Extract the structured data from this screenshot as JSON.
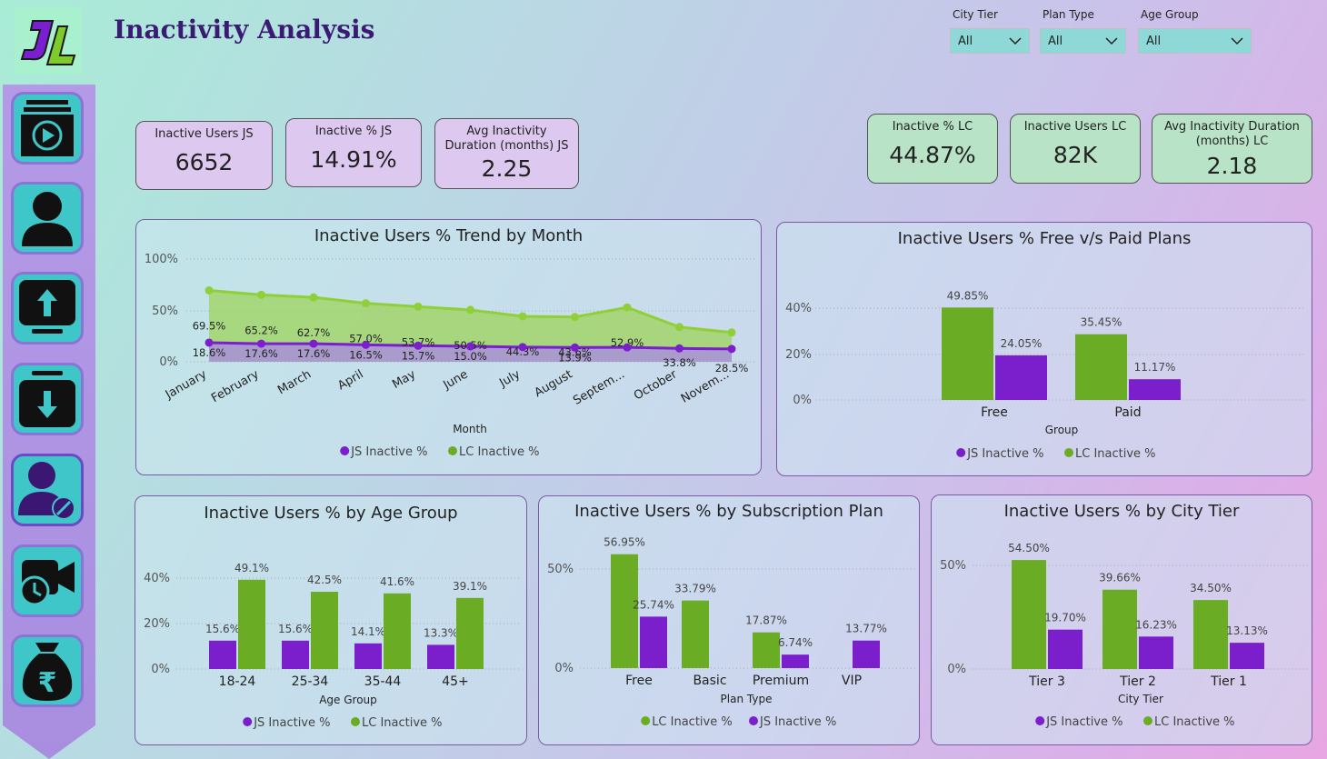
{
  "page": {
    "title": "Inactivity Analysis"
  },
  "colors": {
    "js": "#7b1fcc",
    "lc": "#6aac24",
    "lc_light": "#8fd03a",
    "nav_teal": "#3fc6c9"
  },
  "filters": [
    {
      "label": "City Tier",
      "value": "All"
    },
    {
      "label": "Plan Type",
      "value": "All"
    },
    {
      "label": "Age Group",
      "value": "All"
    }
  ],
  "nav": [
    "dashboard-icon",
    "user-icon",
    "upload-icon",
    "download-icon",
    "user-blocked-icon",
    "video-call-icon",
    "rupee-bag-icon"
  ],
  "kpis_js": [
    {
      "label": "Inactive Users JS",
      "value": "6652"
    },
    {
      "label": "Inactive % JS",
      "value": "14.91%"
    },
    {
      "label1": "Avg Inactivity",
      "label2": "Duration (months) JS",
      "value": "2.25"
    }
  ],
  "kpis_lc": [
    {
      "label": "Inactive % LC",
      "value": "44.87%"
    },
    {
      "label": "Inactive Users LC",
      "value": "82K"
    },
    {
      "label1": "Avg Inactivity Duration",
      "label2": "(months) LC",
      "value": "2.18"
    }
  ],
  "charts": {
    "trend": {
      "title": "Inactive Users % Trend by Month",
      "xlabel": "Month",
      "yticks": [
        "100%",
        "50%",
        "0%"
      ],
      "legend": [
        "JS Inactive %",
        "LC Inactive %"
      ]
    },
    "plans": {
      "title": "Inactive Users % Free v/s Paid Plans",
      "xlabel": "Group",
      "yticks": [
        "40%",
        "20%",
        "0%"
      ],
      "legend": [
        "JS Inactive %",
        "LC Inactive %"
      ]
    },
    "age": {
      "title": "Inactive Users % by Age Group",
      "xlabel": "Age Group",
      "yticks": [
        "40%",
        "20%",
        "0%"
      ],
      "legend": [
        "JS Inactive %",
        "LC Inactive %"
      ]
    },
    "sub": {
      "title": "Inactive Users % by Subscription Plan",
      "xlabel": "Plan Type",
      "yticks": [
        "50%",
        "0%"
      ],
      "legend": [
        "LC Inactive %",
        "JS Inactive %"
      ]
    },
    "city": {
      "title": "Inactive Users % by City Tier",
      "xlabel": "City Tier",
      "yticks": [
        "50%",
        "0%"
      ],
      "legend": [
        "JS Inactive %",
        "LC Inactive %"
      ]
    }
  },
  "chart_data": [
    {
      "type": "area",
      "title": "Inactive Users % Trend by Month",
      "xlabel": "Month",
      "categories": [
        "January",
        "February",
        "March",
        "April",
        "May",
        "June",
        "July",
        "August",
        "Septem...",
        "October",
        "Novem..."
      ],
      "series": [
        {
          "name": "JS Inactive %",
          "values": [
            18.6,
            17.6,
            17.6,
            16.5,
            15.7,
            15.0,
            14.3,
            13.9,
            14.0,
            13.0,
            12.5
          ],
          "labels": [
            "18.6%",
            "17.6%",
            "17.6%",
            "16.5%",
            "15.7%",
            "15.0%",
            "",
            "13.9%",
            "",
            "",
            ""
          ]
        },
        {
          "name": "LC Inactive %",
          "values": [
            69.5,
            65.2,
            62.7,
            57.0,
            53.7,
            50.5,
            44.3,
            43.6,
            52.9,
            33.8,
            28.5
          ],
          "labels": [
            "69.5%",
            "65.2%",
            "62.7%",
            "57.0%",
            "53.7%",
            "50.5%",
            "44.3%",
            "43.6%",
            "52.9%",
            "33.8%",
            "28.5%"
          ]
        }
      ],
      "ylim": [
        0,
        100
      ],
      "legend": "bottom"
    },
    {
      "type": "bar",
      "title": "Inactive Users % Free v/s Paid Plans",
      "xlabel": "Group",
      "categories": [
        "Free",
        "Paid"
      ],
      "series": [
        {
          "name": "LC Inactive %",
          "values": [
            49.85,
            35.45
          ],
          "labels": [
            "49.85%",
            "35.45%"
          ]
        },
        {
          "name": "JS Inactive %",
          "values": [
            24.05,
            11.17
          ],
          "labels": [
            "24.05%",
            "11.17%"
          ]
        }
      ],
      "ylim": [
        0,
        50
      ],
      "legend": "bottom"
    },
    {
      "type": "bar",
      "title": "Inactive Users % by Age Group",
      "xlabel": "Age Group",
      "categories": [
        "18-24",
        "25-34",
        "35-44",
        "45+"
      ],
      "series": [
        {
          "name": "JS Inactive %",
          "values": [
            15.6,
            15.6,
            14.1,
            13.3
          ],
          "labels": [
            "15.6%",
            "15.6%",
            "14.1%",
            "13.3%"
          ]
        },
        {
          "name": "LC Inactive %",
          "values": [
            49.1,
            42.5,
            41.6,
            39.1
          ],
          "labels": [
            "49.1%",
            "42.5%",
            "41.6%",
            "39.1%"
          ]
        }
      ],
      "ylim": [
        0,
        50
      ],
      "legend": "bottom"
    },
    {
      "type": "bar",
      "title": "Inactive Users % by Subscription Plan",
      "xlabel": "Plan Type",
      "categories": [
        "Free",
        "Basic",
        "Premium",
        "VIP"
      ],
      "series": [
        {
          "name": "LC Inactive %",
          "values": [
            56.95,
            33.79,
            17.87,
            null
          ],
          "labels": [
            "56.95%",
            "33.79%",
            "17.87%",
            ""
          ]
        },
        {
          "name": "JS Inactive %",
          "values": [
            25.74,
            null,
            6.74,
            13.77
          ],
          "labels": [
            "25.74%",
            "",
            "6.74%",
            "13.77%"
          ]
        }
      ],
      "ylim": [
        0,
        60
      ],
      "legend": "bottom"
    },
    {
      "type": "bar",
      "title": "Inactive Users % by City Tier",
      "xlabel": "City Tier",
      "categories": [
        "Tier 3",
        "Tier 2",
        "Tier 1"
      ],
      "series": [
        {
          "name": "LC Inactive %",
          "values": [
            54.5,
            39.66,
            34.5
          ],
          "labels": [
            "54.50%",
            "39.66%",
            "34.50%"
          ]
        },
        {
          "name": "JS Inactive %",
          "values": [
            19.7,
            16.23,
            13.13
          ],
          "labels": [
            "19.70%",
            "16.23%",
            "13.13%"
          ]
        }
      ],
      "ylim": [
        0,
        60
      ],
      "legend": "bottom"
    }
  ]
}
